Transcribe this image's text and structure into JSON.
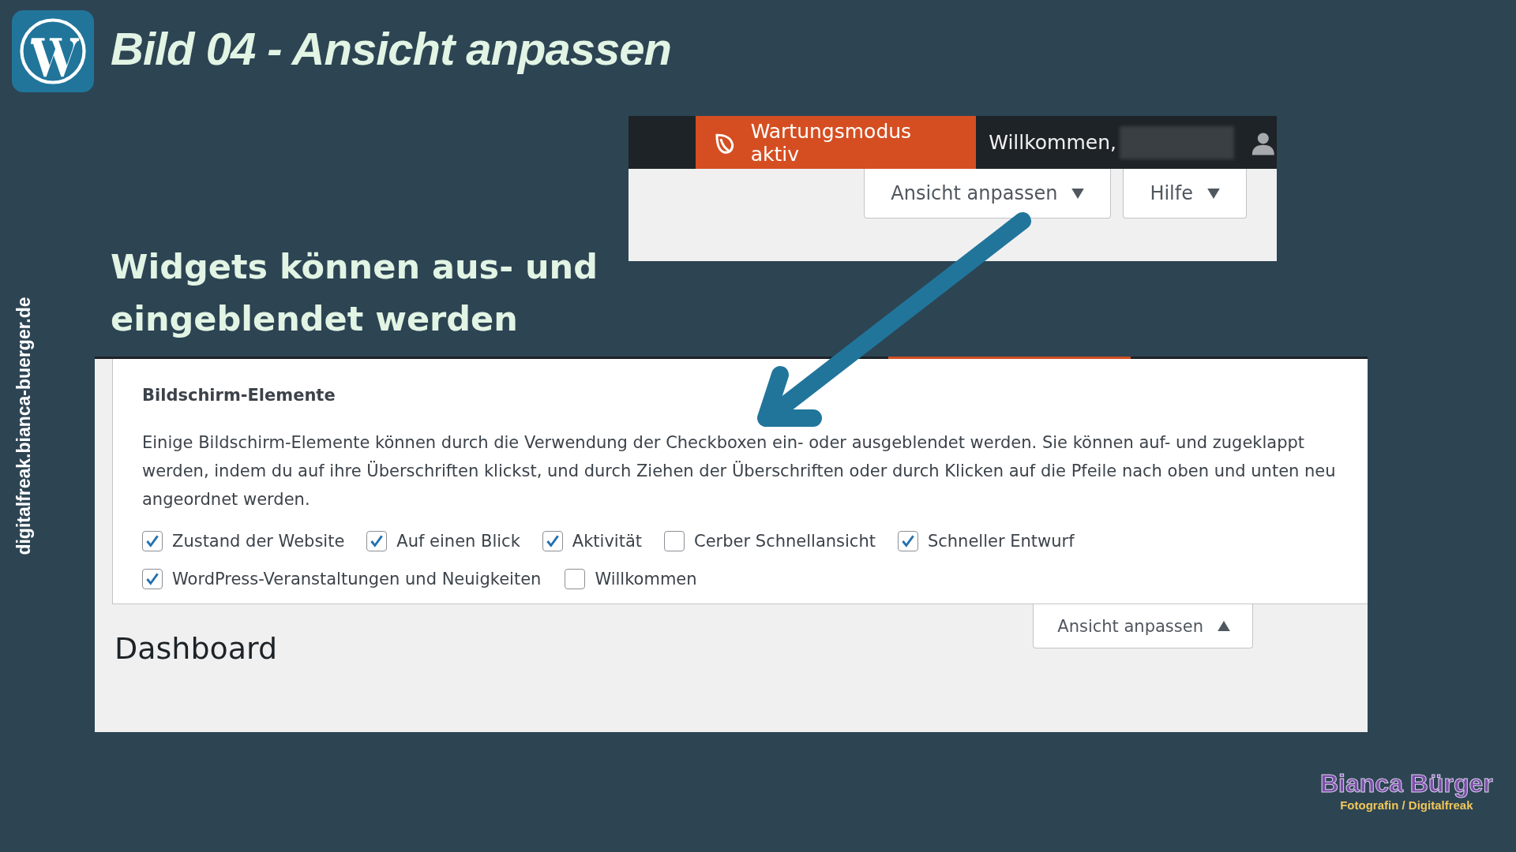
{
  "header": {
    "title": "Bild 04 - Ansicht anpassen"
  },
  "side_url": "digitalfreak.bianca-buerger.de",
  "top_screenshot": {
    "maintenance_badge": "Wartungsmodus aktiv",
    "welcome": "Willkommen,",
    "buttons": [
      {
        "label": "Ansicht anpassen"
      },
      {
        "label": "Hilfe"
      }
    ]
  },
  "caption": "Widgets können aus- und\neingeblendet werden",
  "screen_options": {
    "heading": "Bildschirm-Elemente",
    "description": "Einige Bildschirm-Elemente können durch die Verwendung der Checkboxen ein- oder ausgeblendet werden. Sie können auf- und zugeklappt werden, indem du auf ihre Überschriften klickst, und durch Ziehen der Überschriften oder durch Klicken auf die Pfeile nach oben und unten neu angeordnet werden.",
    "checkboxes": [
      {
        "label": "Zustand der Website",
        "checked": true
      },
      {
        "label": "Auf einen Blick",
        "checked": true
      },
      {
        "label": "Aktivität",
        "checked": true
      },
      {
        "label": "Cerber Schnellansicht",
        "checked": false
      },
      {
        "label": "Schneller Entwurf",
        "checked": true
      },
      {
        "label": "WordPress-Veranstaltungen und Neuigkeiten",
        "checked": true
      },
      {
        "label": "Willkommen",
        "checked": false
      }
    ],
    "toggle_button": "Ansicht anpassen"
  },
  "page_title": "Dashboard",
  "brand": {
    "name": "Bianca Bürger",
    "tagline": "Fotografin / Digitalfreak"
  }
}
